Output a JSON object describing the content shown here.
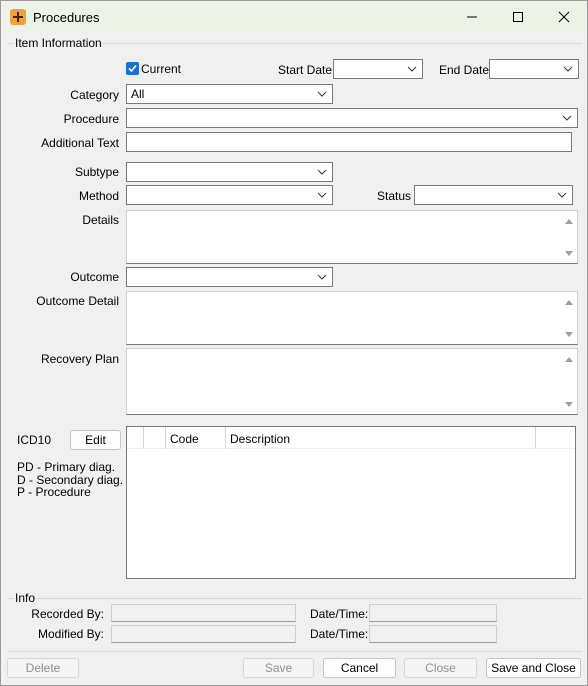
{
  "window": {
    "title": "Procedures"
  },
  "item_info": {
    "group_label": "Item Information",
    "current_label": "Current",
    "current_checked": true,
    "start_date_label": "Start Date",
    "end_date_label": "End Date",
    "category_label": "Category",
    "category_value": "All",
    "procedure_label": "Procedure",
    "additional_text_label": "Additional Text",
    "subtype_label": "Subtype",
    "method_label": "Method",
    "status_label": "Status",
    "details_label": "Details",
    "outcome_label": "Outcome",
    "outcome_detail_label": "Outcome Detail",
    "recovery_plan_label": "Recovery Plan"
  },
  "icd10": {
    "label": "ICD10",
    "edit_button": "Edit",
    "legend": [
      "PD - Primary diag.",
      "D - Secondary diag.",
      "P - Procedure"
    ],
    "columns": [
      "Code",
      "Description"
    ]
  },
  "info": {
    "group_label": "Info",
    "recorded_by_label": "Recorded By:",
    "modified_by_label": "Modified By:",
    "datetime_label": "Date/Time:"
  },
  "footer": {
    "delete": "Delete",
    "save": "Save",
    "cancel": "Cancel",
    "close": "Close",
    "save_and_close": "Save and Close"
  }
}
